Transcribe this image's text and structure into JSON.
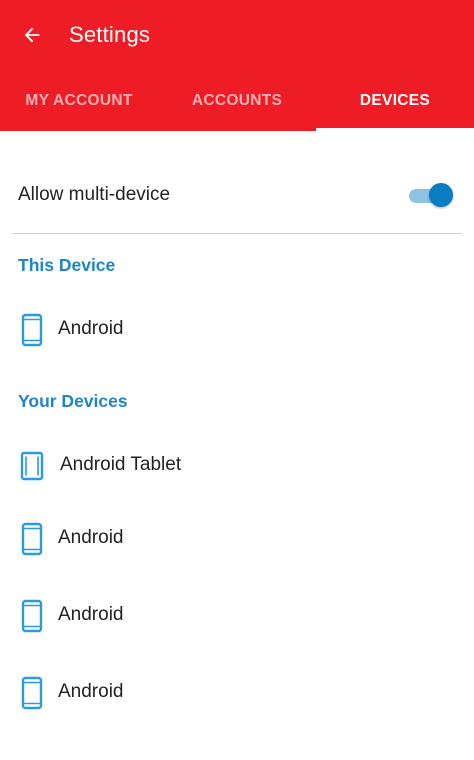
{
  "appbar": {
    "title": "Settings",
    "back_icon": "arrow-back-icon",
    "background_color": "#ee1c25"
  },
  "tabs": [
    {
      "label": "MY ACCOUNT",
      "active": false
    },
    {
      "label": "ACCOUNTS",
      "active": false
    },
    {
      "label": "DEVICES",
      "active": true
    }
  ],
  "settings": {
    "multi_device_label": "Allow multi-device",
    "multi_device_enabled": true
  },
  "this_device": {
    "header": "This Device",
    "devices": [
      {
        "name": "Android",
        "icon": "phone-icon"
      }
    ]
  },
  "your_devices": {
    "header": "Your Devices",
    "devices": [
      {
        "name": "Android Tablet",
        "icon": "tablet-icon"
      },
      {
        "name": "Android",
        "icon": "phone-icon"
      },
      {
        "name": "Android",
        "icon": "phone-icon"
      },
      {
        "name": "Android",
        "icon": "phone-icon"
      }
    ]
  },
  "colors": {
    "accent": "#1e86c6",
    "toggle_thumb": "#0a7dc2",
    "toggle_track": "#8ec3e4",
    "device_icon": "#2a9be0"
  }
}
